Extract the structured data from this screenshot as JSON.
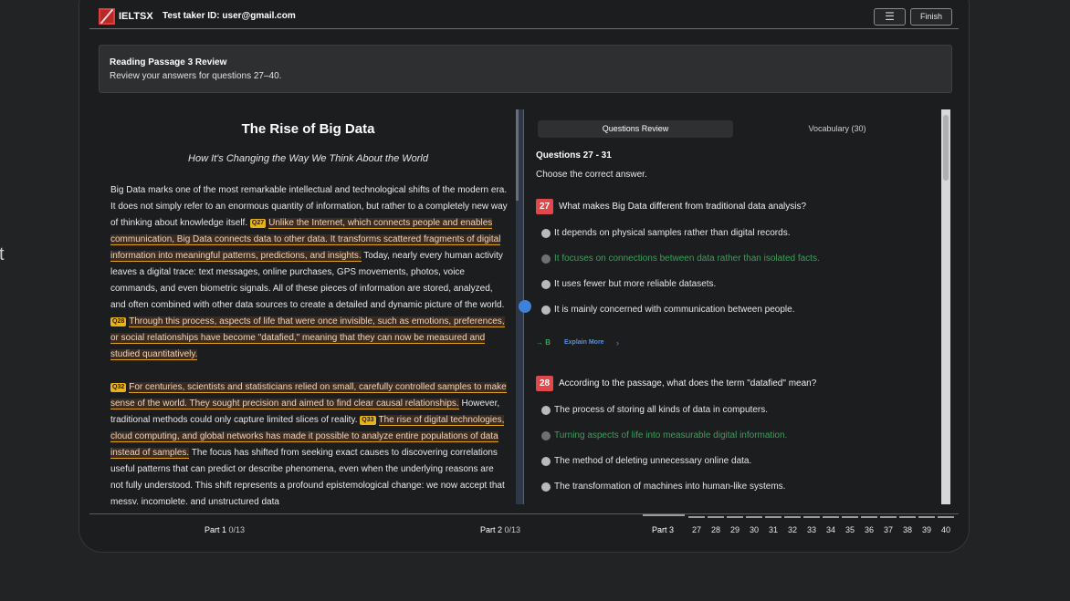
{
  "edge_char": "t",
  "header": {
    "brand": "IELTSX",
    "taker_label": "Test taker ID:",
    "taker_id": "user@gmail.com",
    "menu_icon": "☰",
    "finish_label": "Finish"
  },
  "banner": {
    "title": "Reading Passage 3 Review",
    "subtitle": "Review your answers for questions 27–40."
  },
  "passage": {
    "title": "The Rise of Big Data",
    "subtitle": "How It's Changing the Way We Think About the World",
    "p1": {
      "a": "Big Data marks one of the most remarkable intellectual and technological shifts of the modern era. It does not simply refer to an enormous quantity of information, but rather to a completely new way of thinking about knowledge itself. ",
      "q27_tag": "Q27",
      "q27_text": "Unlike the Internet, which connects people and enables communication, Big Data connects data to other data. It transforms scattered fragments of digital information into meaningful patterns, predictions, and insights.",
      "b": " Today, nearly every human activity leaves a digital trace: text messages, online purchases, GPS movements, photos, voice commands, and even biometric signals. All of these pieces of information are stored, analyzed, and often combined with other data sources to create a detailed and dynamic picture of the world. ",
      "q28_tag": "Q28",
      "q28_text": "Through this process, aspects of life that were once invisible, such as emotions, preferences, or social relationships have become \"datafied,\" meaning that they can now be measured and studied quantitatively."
    },
    "p2": {
      "q32_tag": "Q32",
      "q32_text": "For centuries, scientists and statisticians relied on small, carefully controlled samples to make sense of the world. They sought precision and aimed to find clear causal relationships.",
      "a": " However, traditional methods could only capture limited slices of reality. ",
      "q33_tag": "Q33",
      "q33_text": "The rise of digital technologies, cloud computing, and global networks has made it possible to analyze entire populations of data instead of samples.",
      "b": " The focus has shifted from seeking exact causes to discovering correlations useful patterns that can predict or describe phenomena, even when the underlying reasons are not fully understood. This shift represents a profound epistemological change: we now accept that messy, incomplete, and unstructured data"
    }
  },
  "review": {
    "tabs": [
      "Questions Review",
      "Vocabulary (30)"
    ],
    "range": "Questions 27 - 31",
    "instruction": "Choose the correct answer.",
    "questions": [
      {
        "num": "27",
        "text": "What makes Big Data different from traditional data analysis?",
        "options": [
          "It depends on physical samples rather than digital records.",
          "It focuses on connections between data rather than isolated facts.",
          "It uses fewer but more reliable datasets.",
          "It is mainly concerned with communication between people."
        ],
        "correct_index": 1,
        "answer_label": "→ B",
        "explain_label": "Explain More",
        "explain_chevron": "›"
      },
      {
        "num": "28",
        "text": "According to the passage, what does the term \"datafied\" mean?",
        "options": [
          "The process of storing all kinds of data in computers.",
          "Turning aspects of life into measurable digital information.",
          "The method of deleting unnecessary online data.",
          "The transformation of machines into human-like systems."
        ],
        "correct_index": 1
      }
    ]
  },
  "footer": {
    "parts": [
      {
        "label": "Part 1",
        "count": "0/13"
      },
      {
        "label": "Part 2",
        "count": "0/13"
      },
      {
        "label": "Part 3"
      }
    ],
    "question_numbers": [
      "27",
      "28",
      "29",
      "30",
      "31",
      "32",
      "33",
      "34",
      "35",
      "36",
      "37",
      "38",
      "39",
      "40"
    ]
  },
  "colors": {
    "accent_red": "#e0484b",
    "correct_green": "#35a35a",
    "highlight_tag": "#e7b21a",
    "link_blue": "#4f93e8"
  }
}
